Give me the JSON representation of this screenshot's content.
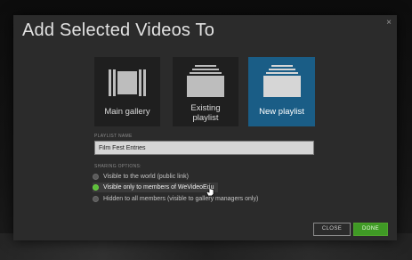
{
  "dialog": {
    "title": "Add Selected Videos To",
    "close_glyph": "×"
  },
  "options": [
    {
      "label_line1": "Main gallery",
      "label_line2": "",
      "icon": "film-strip-icon",
      "selected": false
    },
    {
      "label_line1": "Existing",
      "label_line2": "playlist",
      "icon": "stacked-playlist-icon",
      "selected": false
    },
    {
      "label_line1": "New playlist",
      "label_line2": "",
      "icon": "stacked-playlist-icon",
      "selected": true
    }
  ],
  "playlist": {
    "field_label": "PLAYLIST NAME",
    "value": "Film Fest Entries"
  },
  "sharing": {
    "label": "SHARING OPTIONS:",
    "options": [
      {
        "text": "Visible to the world (public link)",
        "checked": false
      },
      {
        "text": "Visible only to members of WeVideoEdu",
        "checked": true
      },
      {
        "text": "Hidden to all members (visible to gallery managers only)",
        "checked": false
      }
    ]
  },
  "buttons": {
    "close": "CLOSE",
    "done": "DONE"
  },
  "colors": {
    "selected_card": "#1a5d86",
    "done_button": "#3f9a25",
    "radio_checked": "#5cbf3a",
    "modal_bg": "#2b2b2b"
  }
}
